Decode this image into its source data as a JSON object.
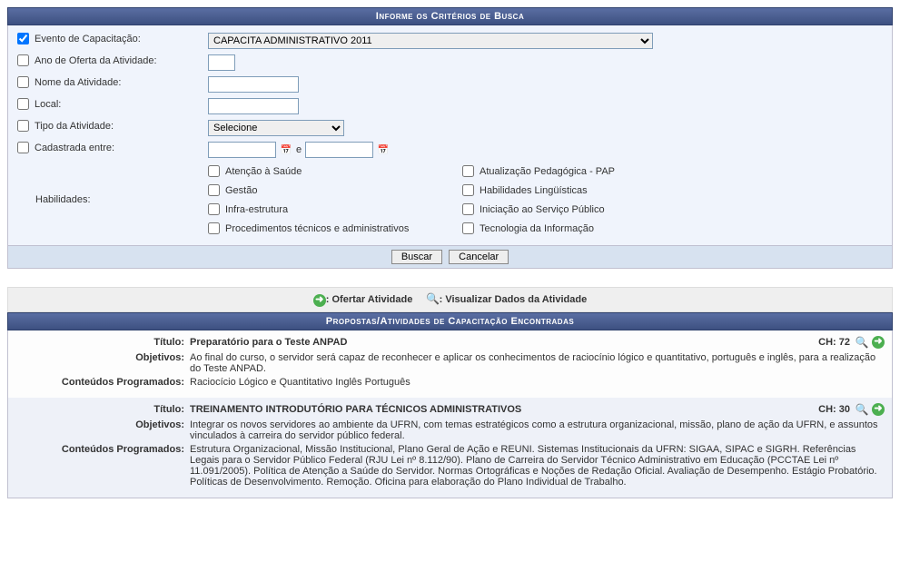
{
  "form": {
    "header": "Informe os Critérios de Busca",
    "fields": {
      "evento": {
        "label": "Evento de Capacitação:",
        "value": "CAPACITA ADMINISTRATIVO 2011",
        "checked": true
      },
      "ano": {
        "label": "Ano de Oferta da Atividade:",
        "value": ""
      },
      "nome": {
        "label": "Nome da Atividade:",
        "value": ""
      },
      "local": {
        "label": "Local:",
        "value": ""
      },
      "tipo": {
        "label": "Tipo da Atividade:",
        "value": "Selecione"
      },
      "cadastrada": {
        "label": "Cadastrada entre:",
        "from": "",
        "to": "",
        "sep": "e"
      },
      "habilidades_label": "Habilidades:"
    },
    "habilidades": [
      "Atenção à Saúde",
      "Atualização Pedagógica - PAP",
      "Gestão",
      "Habilidades Lingüísticas",
      "Infra-estrutura",
      "Iniciação ao Serviço Público",
      "Procedimentos técnicos e administrativos",
      "Tecnologia da Informação"
    ],
    "buttons": {
      "search": "Buscar",
      "cancel": "Cancelar"
    }
  },
  "legend": {
    "offer": ": Ofertar Atividade",
    "view": ": Visualizar Dados da Atividade"
  },
  "results": {
    "header": "Propostas/Atividades de Capacitação Encontradas",
    "labels": {
      "titulo": "Título:",
      "objetivos": "Objetivos:",
      "conteudos": "Conteúdos Programados:",
      "ch": "CH:"
    },
    "items": [
      {
        "titulo": "Preparatório para o Teste ANPAD",
        "ch": "72",
        "objetivos": "Ao final do curso, o servidor será capaz de reconhecer e aplicar os conhecimentos de raciocínio lógico e quantitativo, português e inglês, para a realização do Teste ANPAD.",
        "conteudos": "Raciocício Lógico e Quantitativo Inglês Português"
      },
      {
        "titulo": "TREINAMENTO INTRODUTÓRIO PARA TÉCNICOS ADMINISTRATIVOS",
        "ch": "30",
        "objetivos": "Integrar os novos servidores ao ambiente da UFRN, com temas estratégicos como a estrutura organizacional, missão, plano de ação da UFRN, e assuntos vinculados à carreira do servidor público federal.",
        "conteudos": "Estrutura Organizacional, Missão Institucional, Plano Geral de Ação e REUNI. Sistemas Institucionais da UFRN: SIGAA, SIPAC e SIGRH. Referências Legais para o Servidor Público Federal (RJU Lei nº 8.112/90). Plano de Carreira do Servidor Técnico Administrativo em Educação (PCCTAE Lei nº 11.091/2005). Política de Atenção a Saúde do Servidor. Normas Ortográficas e Noções de Redação Oficial. Avaliação de Desempenho. Estágio Probatório. Políticas de Desenvolvimento. Remoção. Oficina para elaboração do Plano Individual de Trabalho."
      }
    ]
  }
}
